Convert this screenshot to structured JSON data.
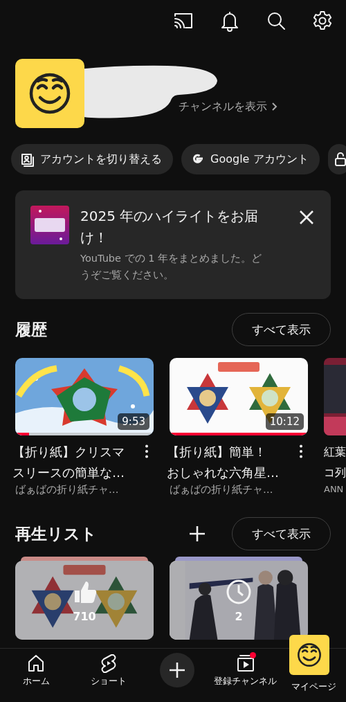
{
  "profile": {
    "view_channel_link": "チャンネルを表示"
  },
  "account_chips": [
    {
      "kind": "switch",
      "label": "アカウントを切り替える"
    },
    {
      "kind": "google",
      "label": "Google アカウント"
    },
    {
      "kind": "cut-off"
    }
  ],
  "promo_card": {
    "title": "2025 年のハイライトをお届け！",
    "body": "YouTube での 1 年をまとめました。どうぞご覧ください。"
  },
  "history": {
    "heading": "履歴",
    "view_all": "すべて表示",
    "videos": [
      {
        "kind": "video",
        "title_lines": [
          "【折り紙】クリスマ",
          "スリースの簡単な…"
        ],
        "channel": "ばぁばの折り紙チャ…",
        "duration": "9:53",
        "level": 0.1
      },
      {
        "kind": "video",
        "title_lines": [
          "【折り紙】簡単！",
          "おしゃれな六角星…"
        ],
        "channel": "ばぁばの折り紙チャ…",
        "duration": "10:12",
        "level": 1
      },
      {
        "kind": "cut-off",
        "title_lines": [
          "紅葉",
          "コ列"
        ],
        "channel": "ANN"
      }
    ]
  },
  "playlists": {
    "heading": "再生リスト",
    "view_all": "すべて表示",
    "items": [
      {
        "kind": "liked",
        "count": "710"
      },
      {
        "kind": "watch-later",
        "count": "2"
      }
    ]
  },
  "bottom_nav": [
    {
      "kind": "home",
      "label": "ホーム",
      "notification_dot": false
    },
    {
      "kind": "shorts",
      "label": "ショート",
      "notification_dot": false
    },
    {
      "kind": "create",
      "notification_dot": false
    },
    {
      "kind": "subscriptions",
      "label": "登録チャンネル",
      "notification_dot": true
    },
    {
      "kind": "you",
      "label": "マイページ",
      "notification_dot": false
    }
  ]
}
